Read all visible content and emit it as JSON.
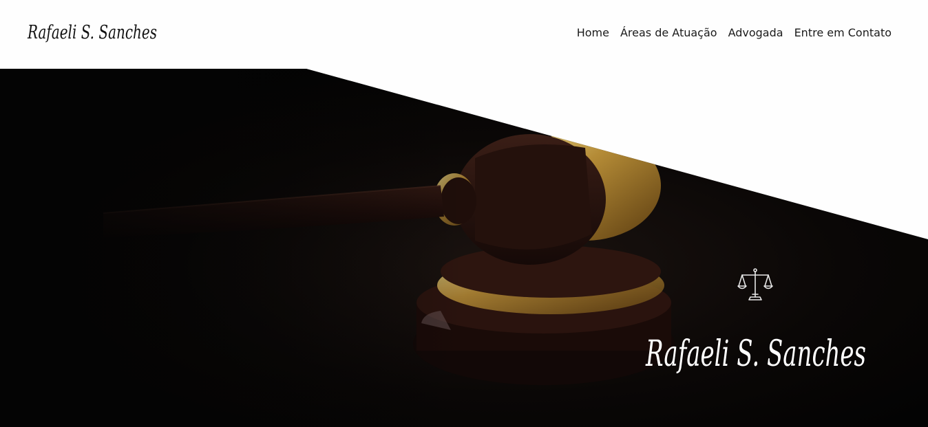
{
  "brand": {
    "name": "Rafaeli S. Sanches"
  },
  "nav": {
    "items": [
      {
        "label": "Home"
      },
      {
        "label": "Áreas de Atuação"
      },
      {
        "label": "Advogada"
      },
      {
        "label": "Entre em Contato"
      }
    ]
  },
  "hero": {
    "signature": "Rafaeli S. Sanches",
    "icon": "scales-of-justice-icon",
    "image": "gavel"
  },
  "colors": {
    "background": "#fefefe",
    "hero_dark": "#050404",
    "gavel_gold": "#c9a54a",
    "gavel_wood": "#3a1d14"
  }
}
